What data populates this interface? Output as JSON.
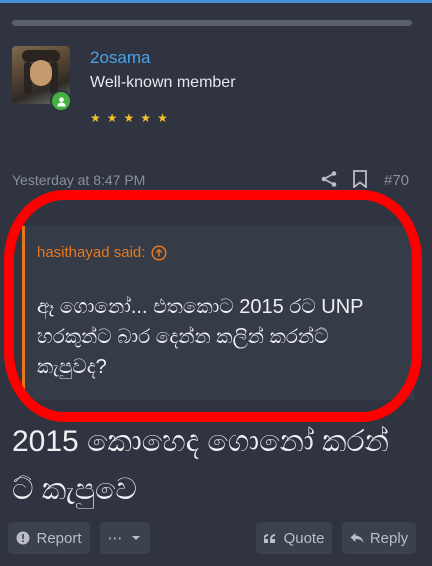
{
  "post": {
    "username": "2osama",
    "user_title": "Well-known member",
    "stars": [
      "★",
      "★",
      "★",
      "★",
      "★"
    ],
    "date": "Yesterday at 8:47 PM",
    "post_number": "#70"
  },
  "quote": {
    "author": "hasithayad said:",
    "text": "ඈ ගොනෝ... එතකොට 2015 රට UNP හරකුන්ට බාර දෙන්න කලින් කරන්ට් කැපුවද?"
  },
  "message": "2015 කොහෙද ගොනෝ කරන් ට් කැපුවෙ",
  "actions": {
    "report": "Report",
    "more": "⋯",
    "quote": "Quote",
    "reply": "Reply"
  },
  "colors": {
    "background": "#2f3440",
    "username": "#4aa3e8",
    "quote_accent": "#e4781e",
    "star": "#f2c12e",
    "highlight": "#ff0000"
  }
}
